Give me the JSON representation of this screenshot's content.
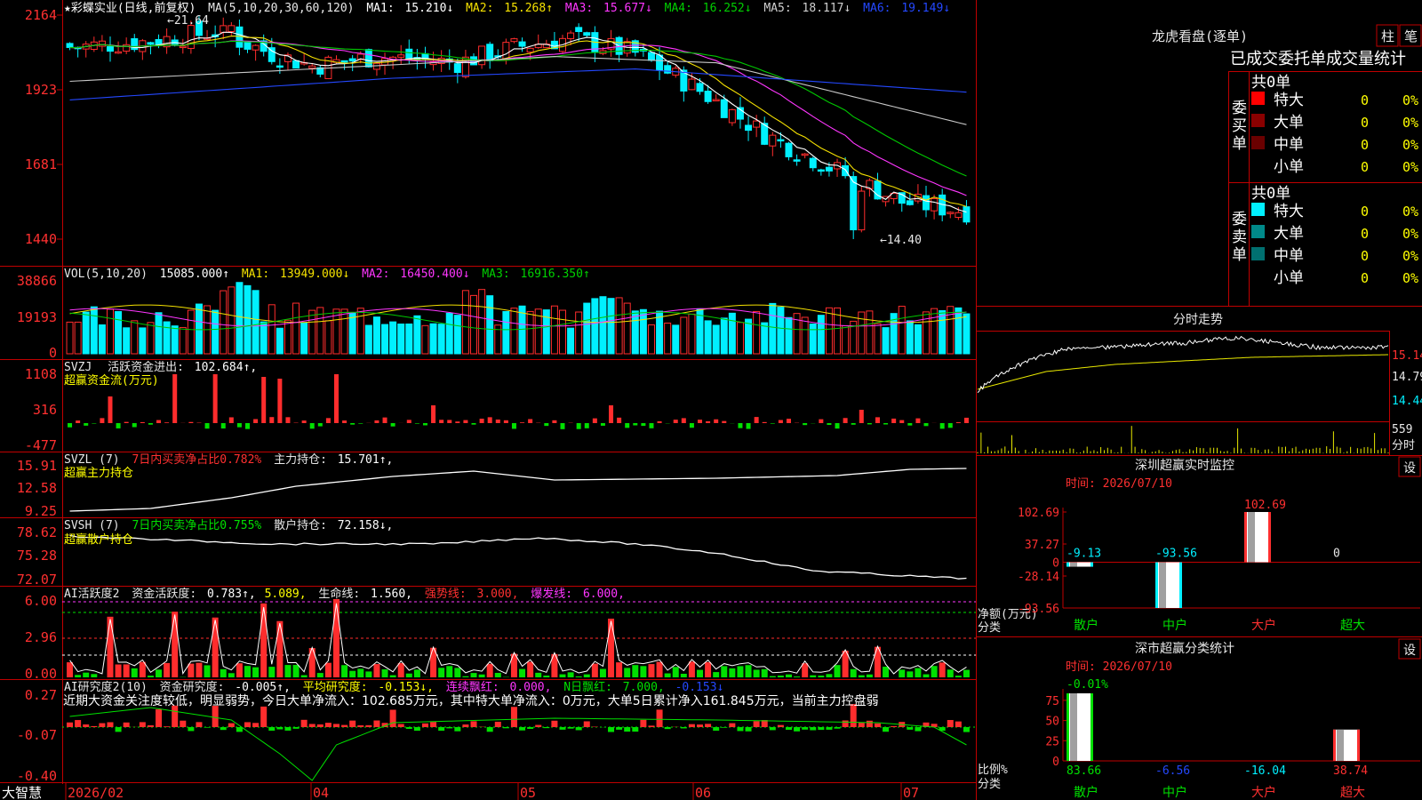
{
  "app": {
    "name": "大智慧"
  },
  "stock": {
    "name": "彩蝶实业",
    "period": "日线",
    "adjust": "前复权"
  },
  "colors": {
    "up": "#ff2d2d",
    "down": "#00f0ff",
    "ma1": "#ffffff",
    "ma2": "#f5e100",
    "ma3": "#ff36ff",
    "ma4": "#00c800",
    "ma5": "#c8c8c8",
    "ma6": "#2448ff",
    "grid": "#c00000",
    "frame": "#c00000",
    "label_yellow": "#ffff00",
    "green": "#00e000",
    "text": "#e8e8e8"
  },
  "main_chart": {
    "header": {
      "title": "★彩蝶实业(日线,前复权)",
      "ma_def": "MA(5,10,20,30,60,120)",
      "items": [
        {
          "label": "MA1:",
          "value": "15.210↓"
        },
        {
          "label": "MA2:",
          "value": "15.268↑"
        },
        {
          "label": "MA3:",
          "value": "15.677↓"
        },
        {
          "label": "MA4:",
          "value": "16.252↓"
        },
        {
          "label": "MA5:",
          "value": "18.117↓"
        },
        {
          "label": "MA6:",
          "value": "19.149↓"
        }
      ]
    },
    "y_ticks": [
      "2164",
      "1923",
      "1681",
      "1440"
    ],
    "y_values": [
      21.64,
      19.23,
      16.81,
      14.4
    ],
    "high_label": "←21.64",
    "low_label": "←14.40"
  },
  "volume": {
    "header": {
      "title": "VOL(5,10,20)",
      "value": "15085.000↑",
      "items": [
        {
          "label": "MA1:",
          "value": "13949.000↓"
        },
        {
          "label": "MA2:",
          "value": "16450.400↓"
        },
        {
          "label": "MA3:",
          "value": "16916.350↑"
        }
      ]
    },
    "y_ticks": [
      "38866",
      "19193",
      "0"
    ],
    "y_values": [
      38866,
      19193,
      0
    ]
  },
  "svzj": {
    "header": {
      "title": "SVZJ",
      "label": "活跃资金进出:",
      "value": "102.684↑,",
      "sub": "超赢资金流(万元)"
    },
    "y_ticks": [
      "1108",
      "316",
      "-477"
    ],
    "y_values": [
      1108,
      316,
      -477
    ]
  },
  "svzl": {
    "header": {
      "title": "SVZL (7)",
      "ratio": "7日内买卖净占比0.782%",
      "label": "主力持仓:",
      "value": "15.701↑,",
      "sub": "超赢主力持仓"
    },
    "y_ticks": [
      "15.91",
      "12.58",
      "9.25"
    ],
    "y_values": [
      15.91,
      12.58,
      9.25
    ]
  },
  "svsh": {
    "header": {
      "title": "SVSH (7)",
      "ratio": "7日内买卖净占比0.755%",
      "label": "散户持仓:",
      "value": "72.158↓,",
      "sub": "超赢散户持仓"
    },
    "y_ticks": [
      "78.62",
      "75.28",
      "72.07"
    ],
    "y_values": [
      78.62,
      75.28,
      72.07
    ]
  },
  "ai_active": {
    "header": {
      "title": "AI活跃度2",
      "l1": "资金活跃度:",
      "v1": "0.783↑,",
      "v2": "5.089,",
      "l3": "生命线:",
      "v3": "1.560,",
      "l4": "强势线:",
      "v4": "3.000,",
      "l5": "爆发线:",
      "v5": "6.000,"
    },
    "y_ticks": [
      "6.00",
      "2.96",
      "0.00"
    ],
    "y_values": [
      6.0,
      2.96,
      0.0
    ]
  },
  "ai_research": {
    "header": {
      "title": "AI研究度2(10)",
      "l1": "资金研究度:",
      "v1": "-0.005↑,",
      "l2": "平均研究度:",
      "v2": "-0.153↓,",
      "l3": "连续飘红:",
      "v3": "0.000,",
      "l4": "N日飘红:",
      "v4": "7.000,",
      "v5": "-0.153↓"
    },
    "comment": "近期大资金关注度较低，明显弱势，今日大单净流入：102.685万元，其中特大单净流入：0万元，大单5日累计净入161.845万元，当前主力控盘弱",
    "y_ticks": [
      "0.27",
      "-0.07",
      "-0.40"
    ],
    "y_values": [
      0.27,
      -0.07,
      -0.4
    ]
  },
  "x_axis": {
    "labels": [
      "2026/02",
      "04",
      "05",
      "06",
      "07"
    ]
  },
  "right": {
    "dragon": {
      "title": "龙虎看盘(逐单)",
      "buttons": [
        "柱",
        "笔"
      ],
      "subtitle": "已成交委托单成交量统计",
      "buy": {
        "side": "委买单",
        "total": "共0单",
        "rows": [
          {
            "label": "特大",
            "count": "0",
            "pct": "0%"
          },
          {
            "label": "大单",
            "count": "0",
            "pct": "0%"
          },
          {
            "label": "中单",
            "count": "0",
            "pct": "0%"
          },
          {
            "label": "小单",
            "count": "0",
            "pct": "0%"
          }
        ]
      },
      "sell": {
        "side": "委卖单",
        "total": "共0单",
        "rows": [
          {
            "label": "特大",
            "count": "0",
            "pct": "0%"
          },
          {
            "label": "大单",
            "count": "0",
            "pct": "0%"
          },
          {
            "label": "中单",
            "count": "0",
            "pct": "0%"
          },
          {
            "label": "小单",
            "count": "0",
            "pct": "0%"
          }
        ]
      }
    },
    "intraday": {
      "title": "分时走势",
      "price_ticks": [
        "15.14",
        "14.79",
        "14.44"
      ],
      "price_values": [
        15.14,
        14.79,
        14.44
      ],
      "vol_tick": "559",
      "vol_unit": "分时"
    },
    "sz_monitor": {
      "title": "深圳超赢实时监控",
      "button": "设",
      "time": "时间: 2026/07/10",
      "y_ticks": [
        "102.69",
        "37.27",
        "0",
        "-28.14",
        "-93.56"
      ],
      "y_values": [
        102.69,
        37.27,
        0,
        -28.14,
        -93.56
      ],
      "unit": "净额(万元)",
      "cat_label": "分类",
      "categories": [
        "散户",
        "中户",
        "大户",
        "超大"
      ],
      "values": [
        -9.13,
        -93.56,
        102.69,
        0
      ],
      "value_labels": [
        "-9.13",
        "-93.56",
        "102.69",
        "0"
      ]
    },
    "market_stats": {
      "title": "深市超赢分类统计",
      "button": "设",
      "time": "时间: 2026/07/10",
      "y_ticks": [
        "75",
        "50",
        "25",
        "0"
      ],
      "y_values": [
        75,
        50,
        25,
        0
      ],
      "unit": "比例%",
      "cat_label": "分类",
      "categories": [
        "散户",
        "中户",
        "大户",
        "超大"
      ],
      "top_label": "-0.01%",
      "values": [
        83.66,
        -6.56,
        -16.04,
        38.74
      ],
      "value_labels": [
        "83.66",
        "-6.56",
        "-16.04",
        "38.74"
      ]
    }
  }
}
